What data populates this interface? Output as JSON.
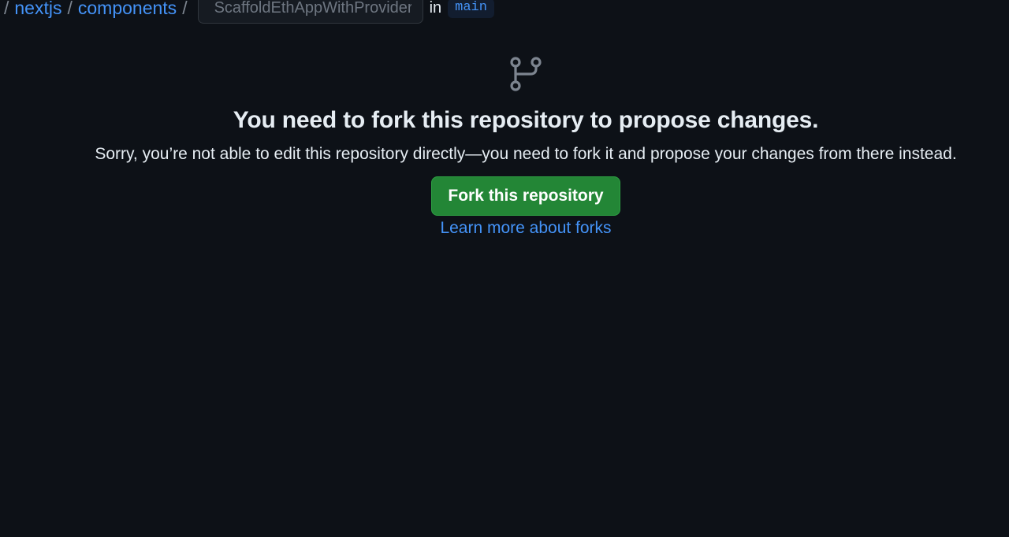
{
  "breadcrumb": {
    "separator": "/",
    "items": [
      "nextjs",
      "components"
    ],
    "filename_placeholder": "ScaffoldEthAppWithProviders.tsx",
    "in_label": "in",
    "branch": "main"
  },
  "blankslate": {
    "icon": "repo-forked-icon",
    "heading": "You need to fork this repository to propose changes.",
    "description": "Sorry, you’re not able to edit this repository directly—you need to fork it and propose your changes from there instead.",
    "fork_button_label": "Fork this repository",
    "learn_more_label": "Learn more about forks"
  },
  "colors": {
    "background": "#0d1117",
    "link": "#4493f8",
    "button_green": "#238636",
    "icon_gray": "#7d8590"
  }
}
